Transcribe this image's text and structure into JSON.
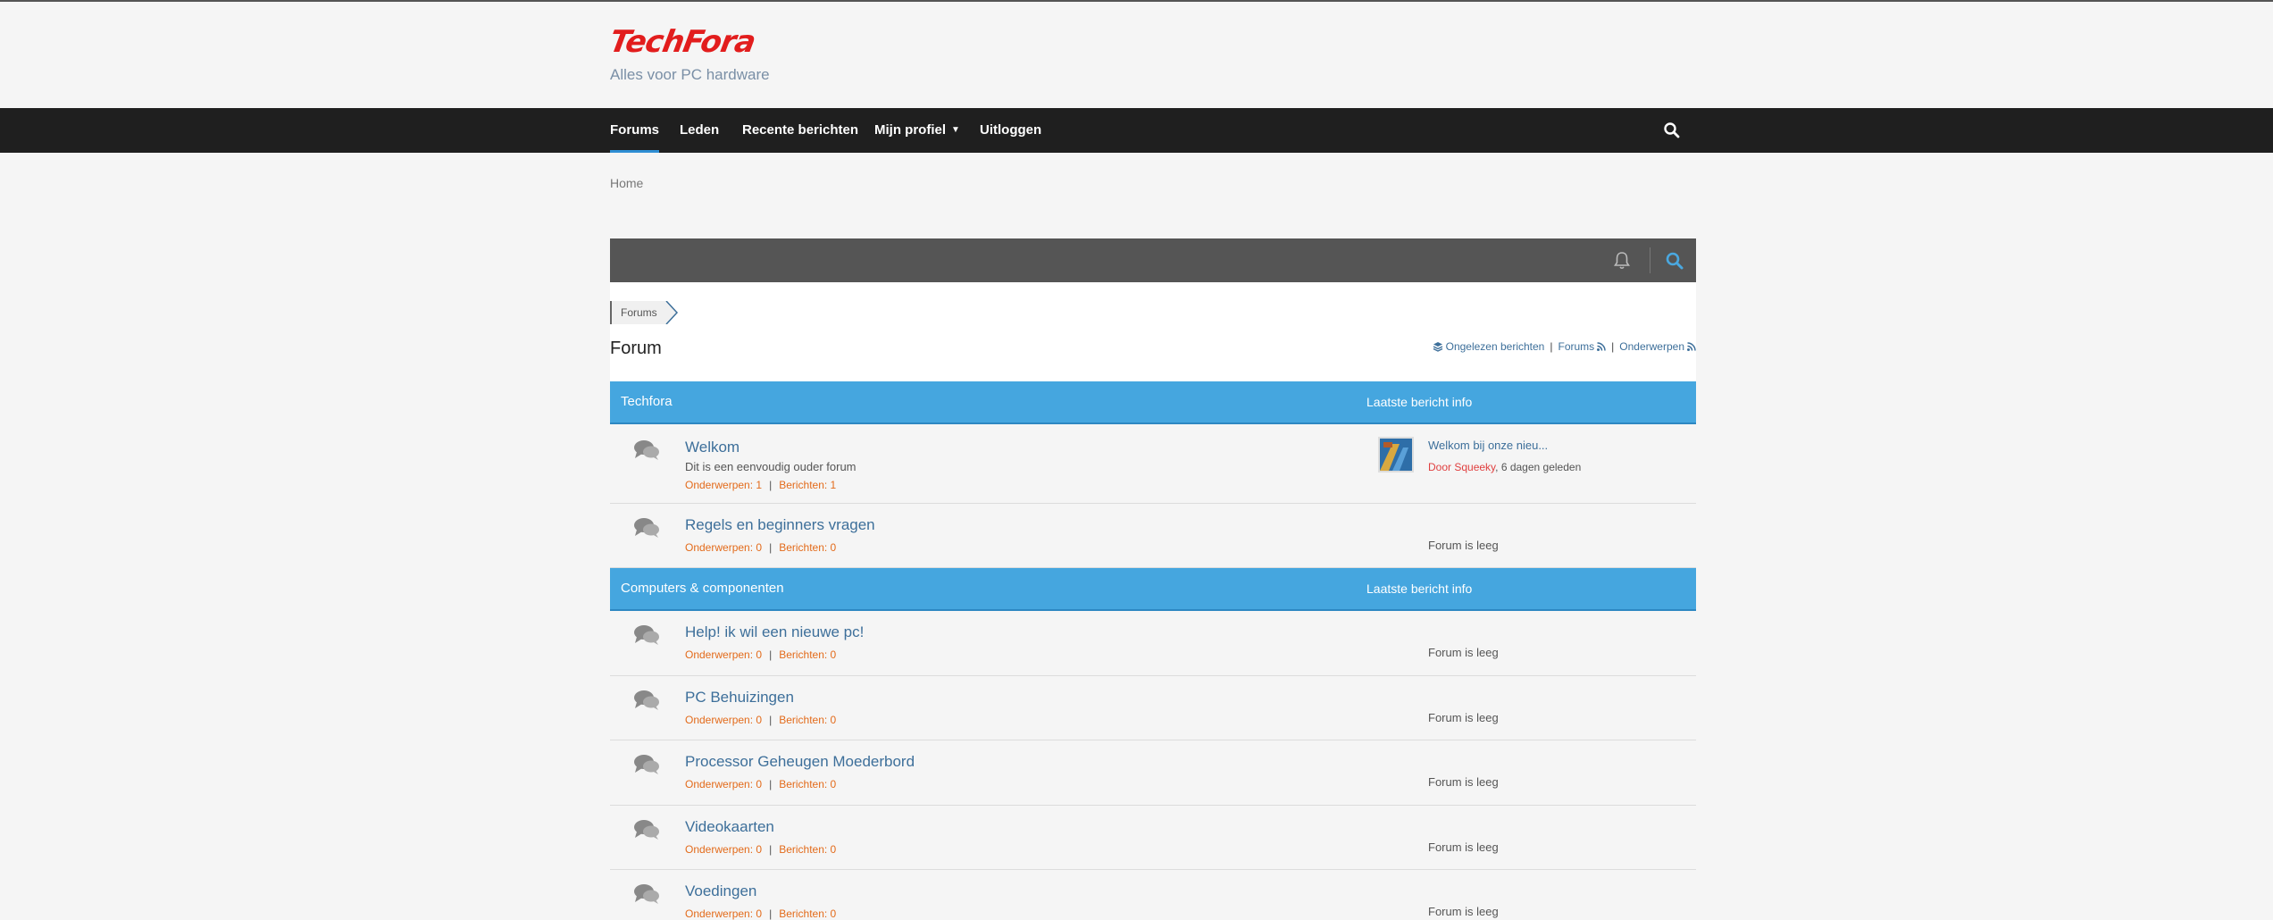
{
  "site": {
    "logo_text": "TechFora",
    "tagline": "Alles voor PC hardware"
  },
  "nav": {
    "items": [
      {
        "label": "Forums",
        "active": true
      },
      {
        "label": "Leden"
      },
      {
        "label": "Recente berichten"
      },
      {
        "label": "Mijn profiel",
        "dropdown": true
      },
      {
        "label": "Uitloggen"
      }
    ],
    "search_icon": "search-icon"
  },
  "breadcrumb": {
    "home": "Home",
    "forums": "Forums"
  },
  "toolbar": {
    "bell_icon": "bell-icon",
    "search_icon": "search-icon"
  },
  "page": {
    "title": "Forum",
    "links": {
      "unread": "Ongelezen berichten",
      "forums": "Forums",
      "topics": "Onderwerpen",
      "separator": "|"
    }
  },
  "categories": [
    {
      "name": "Techfora",
      "last_post_header": "Laatste bericht info",
      "forums": [
        {
          "title": "Welkom",
          "description": "Dit is een eenvoudig ouder forum",
          "topics": "Onderwerpen: 1",
          "posts": "Berichten: 1",
          "last_post": {
            "title": "Welkom bij onze nieu...",
            "by": "Door Squeeky",
            "when": ", 6 dagen geleden"
          }
        },
        {
          "title": "Regels en beginners vragen",
          "topics": "Onderwerpen: 0",
          "posts": "Berichten: 0",
          "empty": "Forum is leeg"
        }
      ]
    },
    {
      "name": "Computers & componenten",
      "last_post_header": "Laatste bericht info",
      "forums": [
        {
          "title": "Help! ik wil een nieuwe pc!",
          "topics": "Onderwerpen: 0",
          "posts": "Berichten: 0",
          "empty": "Forum is leeg"
        },
        {
          "title": "PC Behuizingen",
          "topics": "Onderwerpen: 0",
          "posts": "Berichten: 0",
          "empty": "Forum is leeg"
        },
        {
          "title": "Processor Geheugen Moederbord",
          "topics": "Onderwerpen: 0",
          "posts": "Berichten: 0",
          "empty": "Forum is leeg"
        },
        {
          "title": "Videokaarten",
          "topics": "Onderwerpen: 0",
          "posts": "Berichten: 0",
          "empty": "Forum is leeg"
        },
        {
          "title": "Voedingen",
          "topics": "Onderwerpen: 0",
          "posts": "Berichten: 0",
          "empty": "Forum is leeg"
        }
      ]
    }
  ],
  "colors": {
    "nav_bg": "#1f1f1f",
    "category_bar": "#45a6df",
    "link": "#3d6f9a",
    "stats": "#e36b1b",
    "logo": "#e21d1d"
  }
}
